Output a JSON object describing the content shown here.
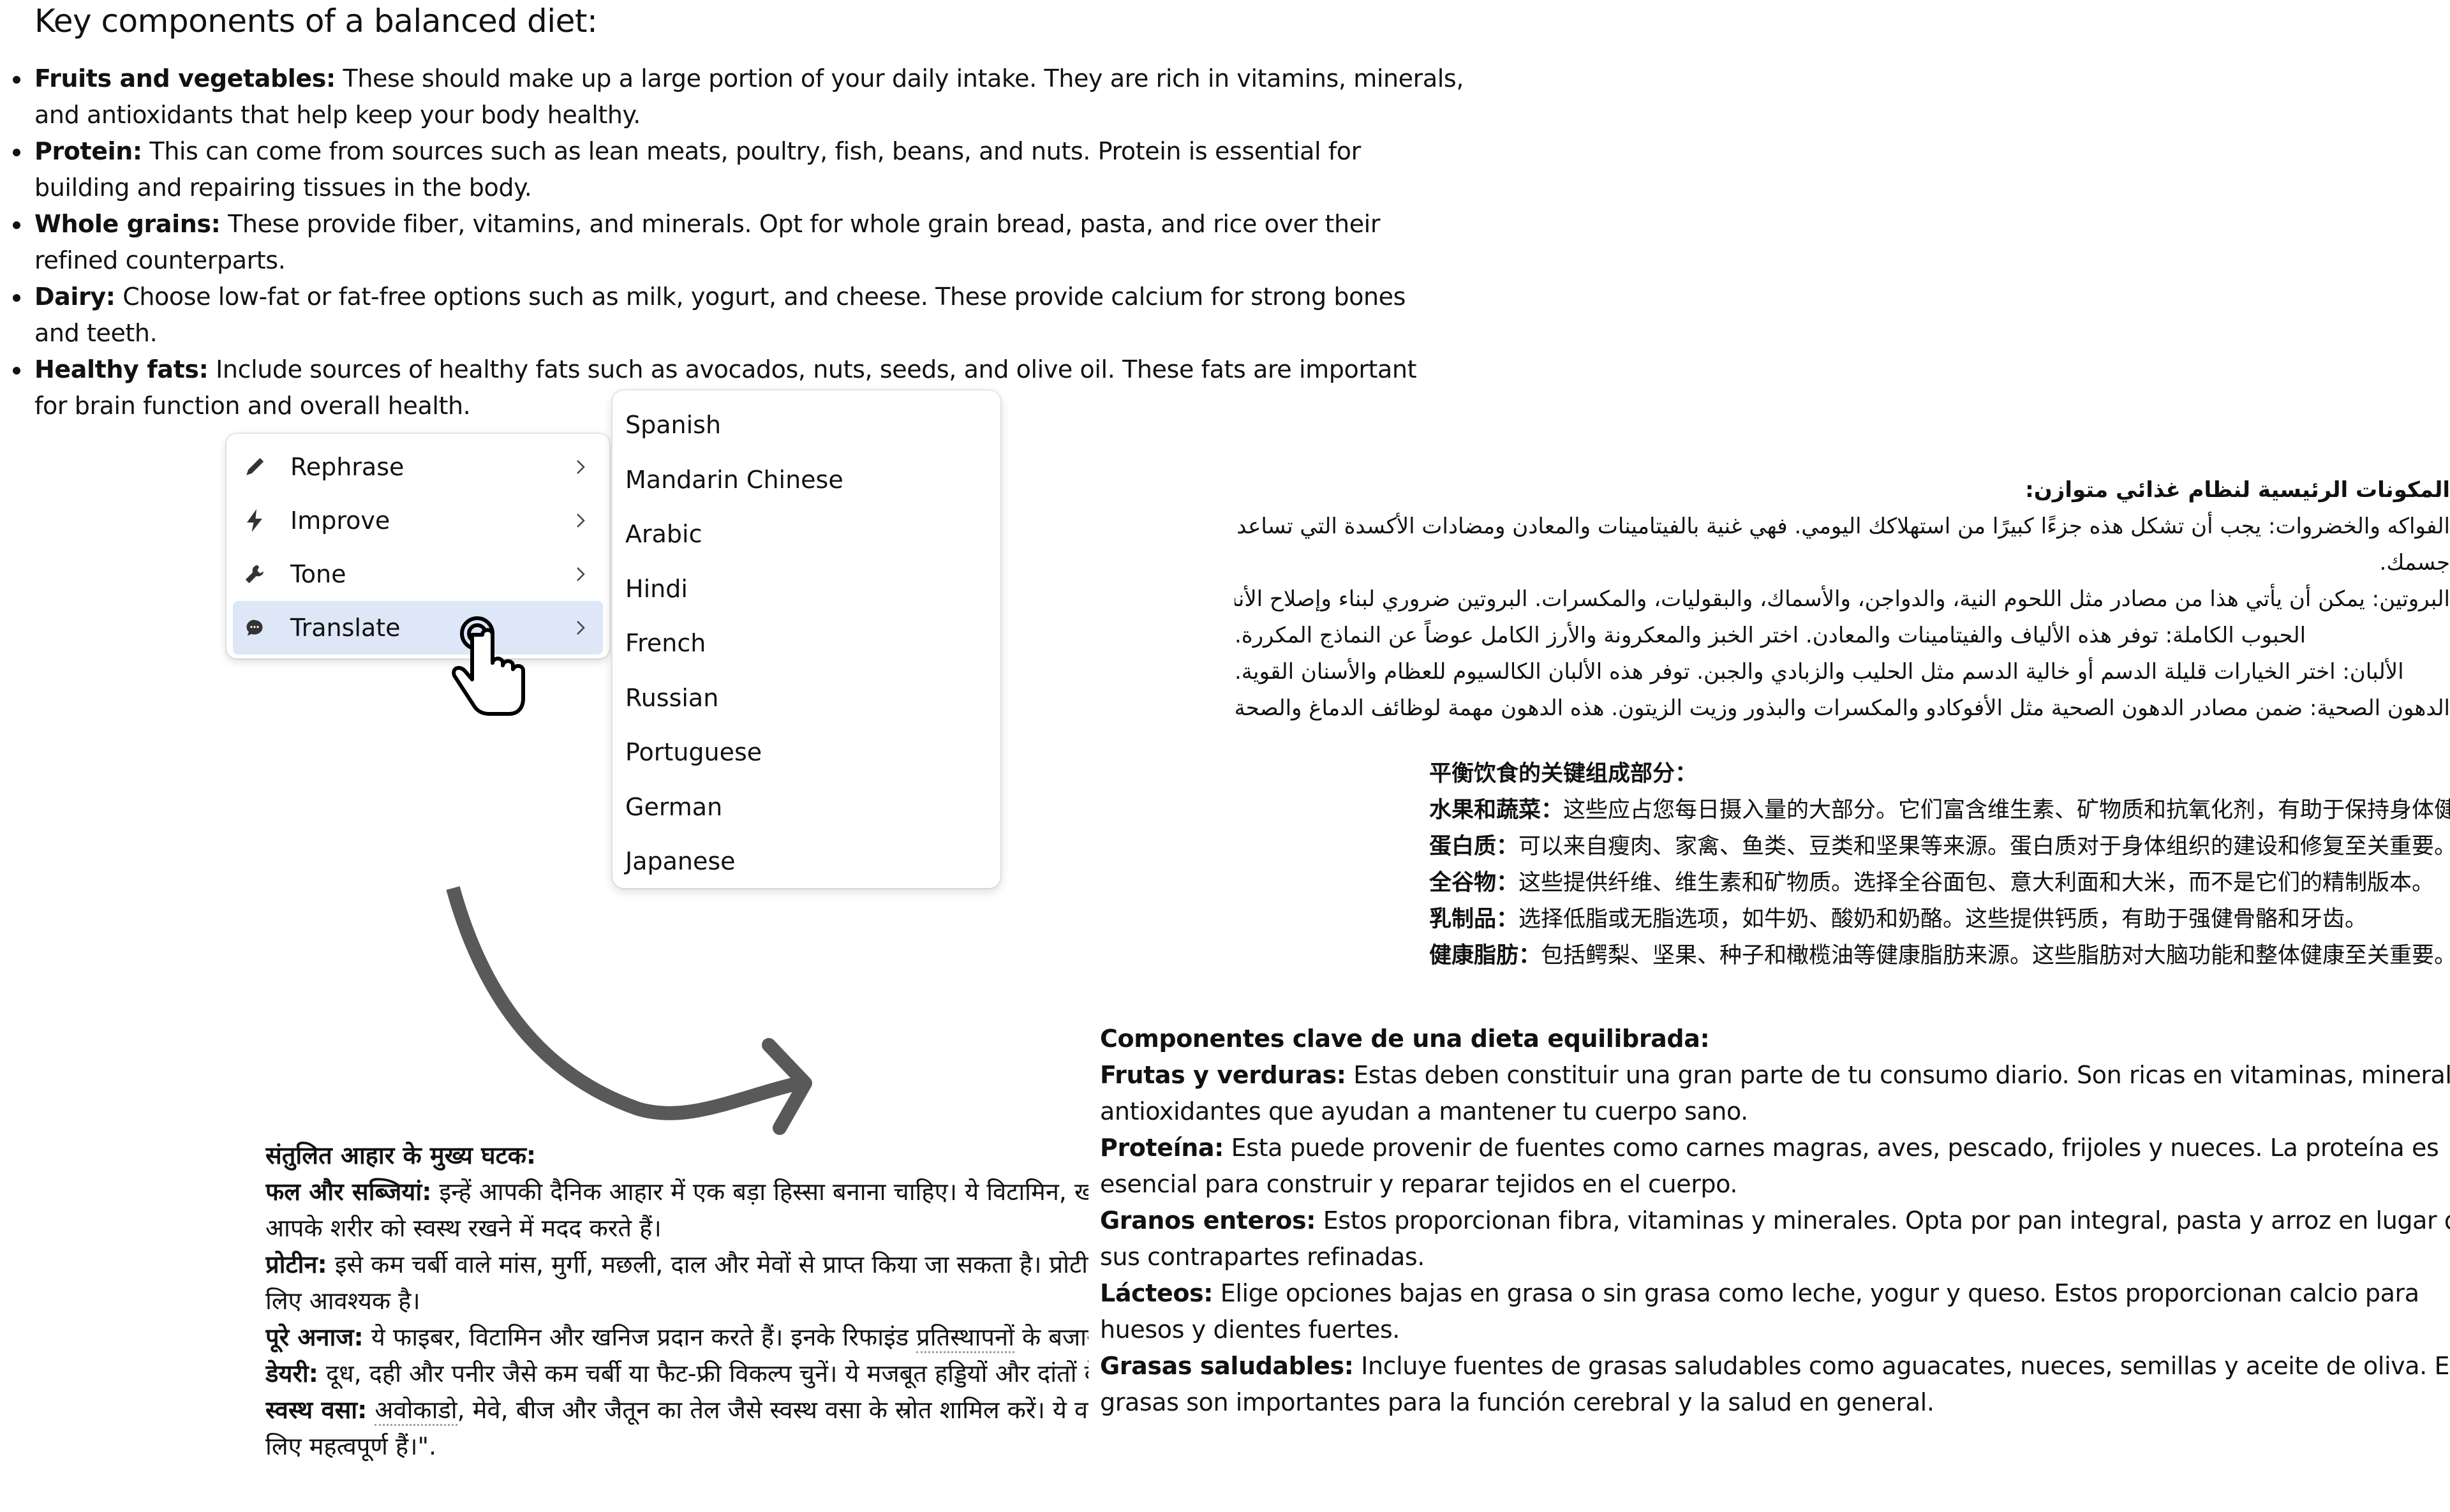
{
  "source": {
    "title": "Key components of a balanced diet:",
    "items": [
      {
        "term": "Fruits and vegetables:",
        "line1": " These should make up a large portion of your daily intake. They are rich in vitamins, minerals,",
        "line2": "and antioxidants that help keep your body healthy."
      },
      {
        "term": "Protein:",
        "line1": " This can come from sources such as lean meats, poultry, fish, beans, and nuts. Protein is essential for",
        "line2": "building and repairing tissues in the body."
      },
      {
        "term": "Whole grains:",
        "line1": " These provide fiber, vitamins, and minerals. Opt for whole grain bread, pasta, and rice over their",
        "line2": "refined counterparts."
      },
      {
        "term": "Dairy:",
        "line1": " Choose low-fat or fat-free options such as milk, yogurt, and cheese. These provide calcium for strong bones",
        "line2": "and teeth."
      },
      {
        "term": "Healthy fats:",
        "line1": " Include sources of healthy fats such as avocados, nuts, seeds, and olive oil. These fats are important",
        "line2": "for brain function and overall health."
      }
    ]
  },
  "menu": {
    "items": [
      {
        "label": "Rephrase",
        "icon": "pencil-icon"
      },
      {
        "label": "Improve",
        "icon": "lightning-icon"
      },
      {
        "label": "Tone",
        "icon": "wrench-icon"
      },
      {
        "label": "Translate",
        "icon": "chat-bubble-icon",
        "active": true
      }
    ],
    "highlight_color": "#dde7f7"
  },
  "submenu": {
    "languages": [
      "Spanish",
      "Mandarin Chinese",
      "Arabic",
      "Hindi",
      "French",
      "Russian",
      "Portuguese",
      "German",
      "Japanese"
    ]
  },
  "translations": {
    "arabic": {
      "lines": [
        "المكونات الرئيسية لنظام غذائي متوازن:",
        "الفواكه والخضروات: يجب أن تشكل هذه جزءًا كبيرًا من استهلاكك اليومي. فهي غنية بالفيتامينات والمعادن ومضادات الأكسدة التي تساعد على الحفاظ على صحة",
        "جسمك.",
        "البروتين: يمكن أن يأتي هذا من مصادر مثل اللحوم النية، والدواجن، والأسماك، والبقوليات، والمكسرات. البروتين ضروري لبناء وإصلاح الأنسجة في الجسم",
        "الحبوب الكاملة: توفر هذه الألياف والفيتامينات والمعادن. اختر الخبز والمعكرونة والأرز الكامل عوضاً عن النماذج المكررة.",
        "الألبان: اختر الخيارات قليلة الدسم أو خالية الدسم مثل الحليب والزبادي والجبن. توفر هذه الألبان الكالسيوم للعظام والأسنان القوية.",
        "الدهون الصحية: ضمن مصادر الدهون الصحية مثل الأفوكادو والمكسرات والبذور وزيت الزيتون. هذه الدهون مهمة لوظائف الدماغ والصحة العامة"
      ]
    },
    "chinese": {
      "title": "平衡饮食的关键组成部分：",
      "items": [
        {
          "term": "水果和蔬菜：",
          "text": "这些应占您每日摄入量的大部分。它们富含维生素、矿物质和抗氧化剂，有助于保持身体健康。"
        },
        {
          "term": "蛋白质：",
          "text": "可以来自瘦肉、家禽、鱼类、豆类和坚果等来源。蛋白质对于身体组织的建设和修复至关重要。"
        },
        {
          "term": "全谷物：",
          "text": "这些提供纤维、维生素和矿物质。选择全谷面包、意大利面和大米，而不是它们的精制版本。"
        },
        {
          "term": "乳制品：",
          "text": "选择低脂或无脂选项，如牛奶、酸奶和奶酪。这些提供钙质，有助于强健骨骼和牙齿。"
        },
        {
          "term": "健康脂肪：",
          "text": "包括鳄梨、坚果、种子和橄榄油等健康脂肪来源。这些脂肪对大脑功能和整体健康至关重要。"
        }
      ]
    },
    "spanish": {
      "title": "Componentes clave de una dieta equilibrada:",
      "items": [
        {
          "term": "Frutas y verduras:",
          "line1": " Estas deben constituir una gran parte de tu consumo diario. Son ricas en vitaminas, minerales y",
          "line2": "antioxidantes que ayudan a mantener tu cuerpo sano."
        },
        {
          "term": "Proteína:",
          "line1": " Esta puede provenir de fuentes como carnes magras, aves, pescado, frijoles y nueces. La proteína es",
          "line2": "esencial para construir y reparar tejidos en el cuerpo."
        },
        {
          "term": "Granos enteros:",
          "line1": " Estos proporcionan fibra, vitaminas y minerales. Opta por pan integral, pasta y arroz en lugar de",
          "line2": "sus contrapartes refinadas."
        },
        {
          "term": "Lácteos:",
          "line1": " Elige opciones bajas en grasa o sin grasa como leche, yogur y queso. Estos proporcionan calcio para",
          "line2": "huesos y dientes fuertes."
        },
        {
          "term": "Grasas saludables:",
          "line1": " Incluye fuentes de grasas saludables como aguacates, nueces, semillas y aceite de oliva. Estas",
          "line2": "grasas son importantes para la función cerebral y la salud en general."
        }
      ]
    },
    "hindi": {
      "title": "संतुलित आहार के मुख्य घटक:",
      "items": [
        {
          "term": "फल और सब्जियां:",
          "line1": " इन्हें आपकी दैनिक आहार में एक बड़ा हिस्सा बनाना चाहिए। ये विटामिन, खनिज और एंटीऑक्सिडेंट से भरपूर होते हैं जो",
          "line2": "आपके शरीर को स्वस्थ रखने में मदद करते हैं।"
        },
        {
          "term": "प्रोटीन:",
          "line1": " इसे कम चर्बी वाले मांस, मुर्गी, मछली, दाल और मेवों से प्राप्त किया जा सकता है। प्रोटीन शरीर में ऊतकों के निर्माण और मरम्मत के",
          "line2": "लिए आवश्यक है।"
        },
        {
          "term": "पूरे अनाज:",
          "line1": " ये फाइबर, विटामिन और खनिज प्रदान करते हैं। इनके रिफाइंड ",
          "flagged": "प्रतिस्थापनों",
          "line1_after": " के बजाय पूरे अनाज की रोटी चुनें।",
          "line2": ""
        },
        {
          "term": "डेयरी:",
          "line1": " दूध, दही और पनीर जैसे कम चर्बी या फैट-फ्री विकल्प चुनें। ये मजबूत हड्डियों और दांतों के लिए कैल्शियम प्रदान करते हैं।",
          "line2": ""
        },
        {
          "term": "स्वस्थ वसा:",
          "flagged": "अवोकाडो",
          "line1": ", मेवे, बीज और जैतून का तेल जैसे स्वस्थ वसा के स्रोत शामिल करें। ये वसा मस्तिष्क के कार्य और समग्र स्वास्थ्य के",
          "line2": "लिए महत्वपूर्ण हैं।\"."
        }
      ]
    }
  }
}
